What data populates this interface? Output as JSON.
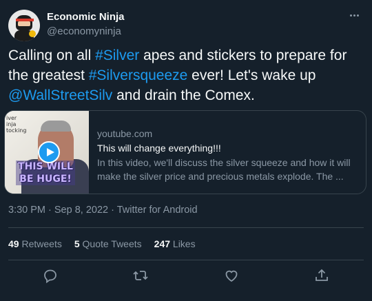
{
  "author": {
    "name": "Economic Ninja",
    "handle": "@economyninja"
  },
  "tweet": {
    "segments": [
      {
        "text": "Calling on all ",
        "link": false
      },
      {
        "text": "#Silver",
        "link": true
      },
      {
        "text": " apes and stickers to prepare for the greatest ",
        "link": false
      },
      {
        "text": "#Silversqueeze",
        "link": true
      },
      {
        "text": " ever! Let's wake up ",
        "link": false
      },
      {
        "text": "@WallStreetSilv",
        "link": true
      },
      {
        "text": " and drain the Comex.",
        "link": false
      }
    ]
  },
  "card": {
    "domain": "youtube.com",
    "title": "This will change everything!!!",
    "description": "In this video, we'll discuss the silver squeeze and how it will make the silver price and precious metals explode. The ...",
    "thumb_caption": "THIS WILL BE HUGE!",
    "thumb_scribble": "iver\ninja\ntocking"
  },
  "meta": "3:30 PM · Sep 8, 2022 · Twitter for Android",
  "stats": {
    "retweets_count": "49",
    "retweets_label": "Retweets",
    "quotes_count": "5",
    "quotes_label": "Quote Tweets",
    "likes_count": "247",
    "likes_label": "Likes"
  },
  "actions": [
    {
      "name": "reply-icon"
    },
    {
      "name": "retweet-icon"
    },
    {
      "name": "like-icon"
    },
    {
      "name": "share-icon"
    }
  ],
  "colors": {
    "background": "#15202b",
    "link": "#1d9bf0",
    "secondary_text": "#8b98a5",
    "border": "#38444d"
  }
}
